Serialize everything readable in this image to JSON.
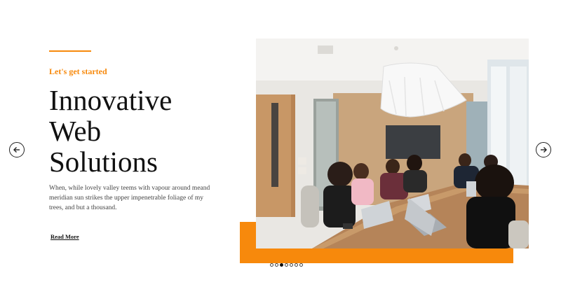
{
  "hero": {
    "eyebrow": "Let's get started",
    "headline_lines": [
      "Innovative",
      "Web",
      "Solutions"
    ],
    "body": "When, while lovely valley teems with vapour around meand meridian sun strikes the upper impenetrable foliage of my trees, and but a thousand.",
    "cta_label": "Read More"
  },
  "slider": {
    "slide_count": 7,
    "active_index": 2,
    "prev_icon": "arrow-left-icon",
    "next_icon": "arrow-right-icon"
  },
  "colors": {
    "accent": "#f7890c",
    "text": "#111111"
  }
}
